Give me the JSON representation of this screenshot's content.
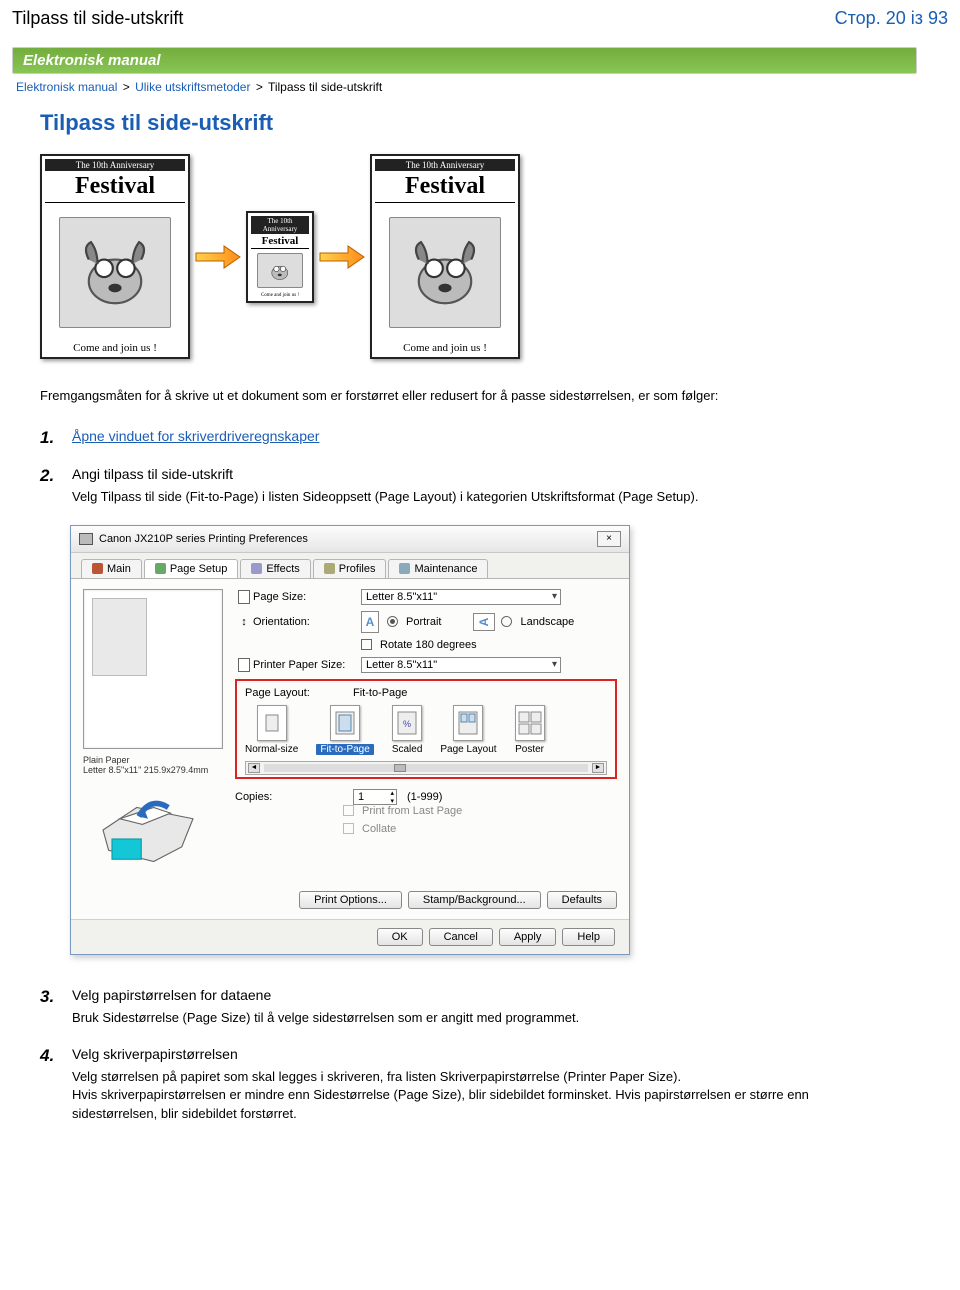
{
  "header": {
    "title": "Tilpass til side-utskrift",
    "page_indicator": "Стор. 20 із 93"
  },
  "green_bar": "Elektronisk manual",
  "breadcrumb": {
    "link1": "Elektronisk manual",
    "link2": "Ulike utskriftsmetoder",
    "link3": "Tilpass til side-utskrift"
  },
  "page_title": "Tilpass til side-utskrift",
  "poster": {
    "anniversary": "The 10th Anniversary",
    "festival": "Festival",
    "footer": "Come and join us !"
  },
  "intro": "Fremgangsmåten for å skrive ut et dokument som er forstørret eller redusert for å passe sidestørrelsen, er som følger:",
  "steps": {
    "s1": {
      "num": "1.",
      "title": "Åpne vinduet for skriverdriveregnskaper"
    },
    "s2": {
      "num": "2.",
      "title": "Angi tilpass til side-utskrift",
      "desc": "Velg Tilpass til side (Fit-to-Page) i listen Sideoppsett (Page Layout) i kategorien Utskriftsformat (Page Setup)."
    },
    "s3": {
      "num": "3.",
      "title": "Velg papirstørrelsen for dataene",
      "desc": "Bruk Sidestørrelse (Page Size) til å velge sidestørrelsen som er angitt med programmet."
    },
    "s4": {
      "num": "4.",
      "title": "Velg skriverpapirstørrelsen",
      "desc1": "Velg størrelsen på papiret som skal legges i skriveren, fra listen Skriverpapirstørrelse (Printer Paper Size).",
      "desc2": "Hvis skriverpapirstørrelsen er mindre enn Sidestørrelse (Page Size), blir sidebildet forminsket. Hvis papirstørrelsen er større enn sidestørrelsen, blir sidebildet forstørret."
    }
  },
  "dialog": {
    "title": "Canon JX210P series Printing Preferences",
    "close": "×",
    "tabs": {
      "main": "Main",
      "page_setup": "Page Setup",
      "effects": "Effects",
      "profiles": "Profiles",
      "maintenance": "Maintenance"
    },
    "preview": {
      "line1": "Plain Paper",
      "line2": "Letter 8.5\"x11\" 215.9x279.4mm"
    },
    "settings": {
      "page_size_label": "Page Size:",
      "page_size_value": "Letter 8.5\"x11\"",
      "orientation_label": "Orientation:",
      "portrait": "Portrait",
      "landscape": "Landscape",
      "rotate": "Rotate 180 degrees",
      "printer_paper_label": "Printer Paper Size:",
      "printer_paper_value": "Letter 8.5\"x11\"",
      "page_layout_label": "Page Layout:",
      "page_layout_value": "Fit-to-Page",
      "opts": {
        "normal": "Normal-size",
        "fit": "Fit-to-Page",
        "scaled": "Scaled",
        "layout": "Page Layout",
        "poster": "Poster"
      },
      "copies_label": "Copies:",
      "copies_value": "1",
      "copies_range": "(1-999)",
      "print_last": "Print from Last Page",
      "collate": "Collate"
    },
    "buttons": {
      "print_options": "Print Options...",
      "stamp": "Stamp/Background...",
      "defaults": "Defaults",
      "ok": "OK",
      "cancel": "Cancel",
      "apply": "Apply",
      "help": "Help"
    }
  }
}
